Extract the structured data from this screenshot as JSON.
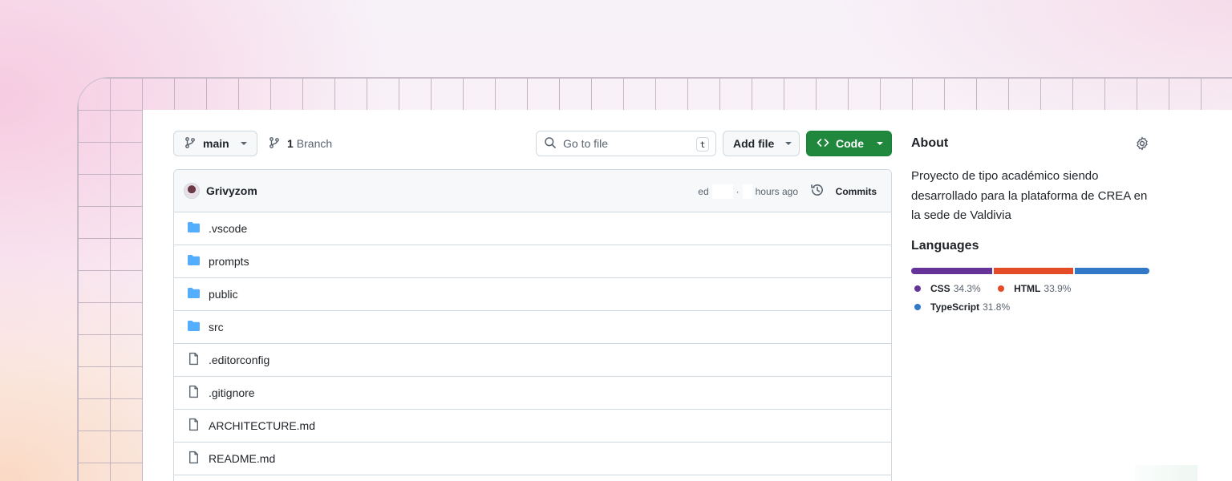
{
  "toolbar": {
    "branch_label": "main",
    "branch_count": "1",
    "branch_suffix": "Branch",
    "search_placeholder": "Go to file",
    "search_shortcut": "t",
    "add_file_label": "Add file",
    "code_label": "Code"
  },
  "commit": {
    "author": "Grivyzom",
    "hash_prefix": "ed",
    "separator": "·",
    "time_suffix": "hours ago",
    "commits_label": "Commits"
  },
  "files": [
    {
      "name": ".vscode",
      "type": "folder"
    },
    {
      "name": "prompts",
      "type": "folder"
    },
    {
      "name": "public",
      "type": "folder"
    },
    {
      "name": "src",
      "type": "folder"
    },
    {
      "name": ".editorconfig",
      "type": "file"
    },
    {
      "name": ".gitignore",
      "type": "file"
    },
    {
      "name": "ARCHITECTURE.md",
      "type": "file"
    },
    {
      "name": "README.md",
      "type": "file"
    }
  ],
  "about": {
    "title": "About",
    "description": "Proyecto de tipo académico siendo desarrollado para la plataforma de CREA en la sede de Valdivia"
  },
  "languages": {
    "title": "Languages",
    "items": [
      {
        "name": "CSS",
        "percent": "34.3%",
        "value": 34.3,
        "color": "#663399"
      },
      {
        "name": "HTML",
        "percent": "33.9%",
        "value": 33.9,
        "color": "#e34c26"
      },
      {
        "name": "TypeScript",
        "percent": "31.8%",
        "value": 31.8,
        "color": "#3178c6"
      }
    ]
  },
  "colors": {
    "accent_green": "#1f883d",
    "folder_blue": "#54aeff",
    "muted": "#59636e"
  },
  "icons": {
    "branch": "git-branch-icon",
    "search": "search-icon",
    "code": "code-icon",
    "history": "history-icon",
    "folder": "folder-icon",
    "file": "file-icon",
    "gear": "gear-icon"
  }
}
